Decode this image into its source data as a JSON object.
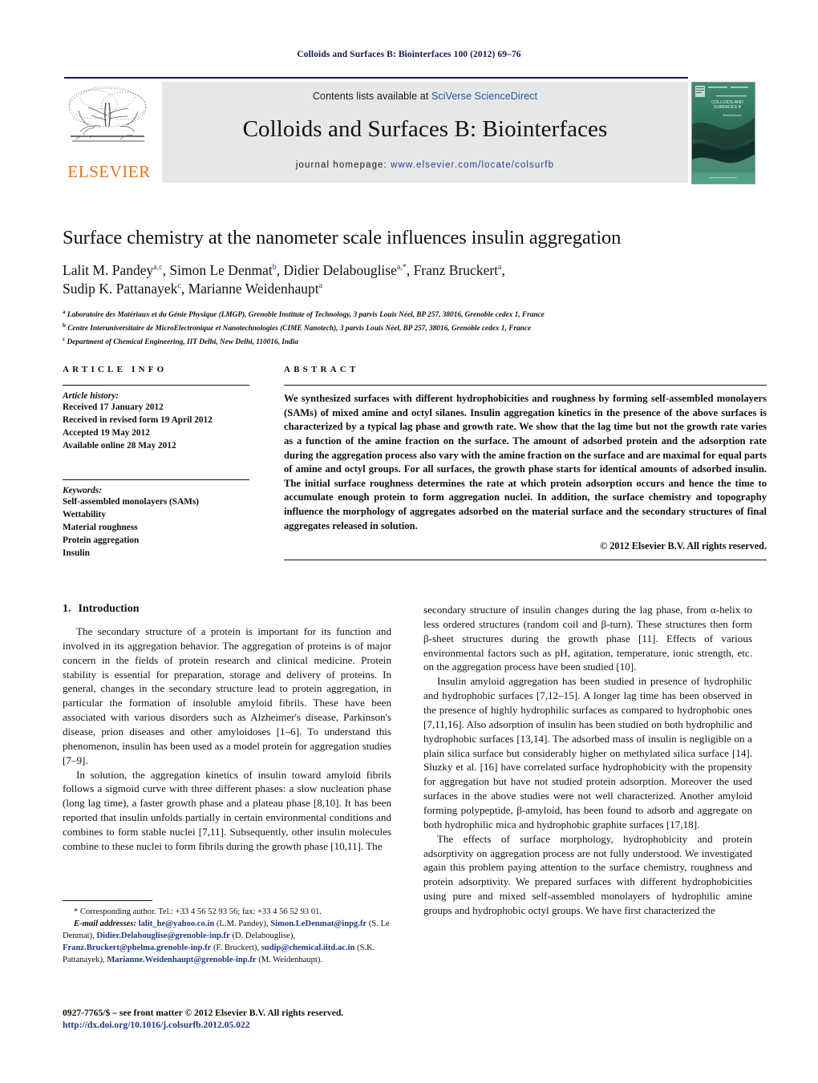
{
  "running_head": "Colloids and Surfaces B: Biointerfaces 100 (2012) 69–76",
  "masthead": {
    "contents_prefix": "Contents lists available at ",
    "sciencedirect": "SciVerse ScienceDirect",
    "journal_title": "Colloids and Surfaces B: Biointerfaces",
    "homepage_prefix": "journal homepage: ",
    "homepage_url": "www.elsevier.com/locate/colsurfb",
    "publisher": "ELSEVIER",
    "cover_line1": "COLLOIDS AND",
    "cover_line2": "SURFACES B",
    "cover_line3": "Biointerfaces",
    "accent_blue": "#0d1b56",
    "link_blue": "#2457a0",
    "elsevier_orange": "#e8731d",
    "band_gray": "#e6e7e8",
    "cover_green": "#2f7a62"
  },
  "title": "Surface chemistry at the nanometer scale influences insulin aggregation",
  "authors": [
    {
      "name": "Lalit M. Pandey",
      "sup": "a,c",
      "sep": ", "
    },
    {
      "name": "Simon Le Denmat",
      "sup": "b",
      "sep": ", "
    },
    {
      "name": "Didier Delabouglise",
      "sup": "a,*",
      "sep": ", "
    },
    {
      "name": "Franz Bruckert",
      "sup": "a",
      "sep": ","
    },
    {
      "name": "Sudip K. Pattanayek",
      "sup": "c",
      "sep": ", "
    },
    {
      "name": "Marianne Weidenhaupt",
      "sup": "a",
      "sep": ""
    }
  ],
  "affiliations": [
    {
      "marker": "a",
      "text": "Laboratoire des Matériaux et du Génie Physique (LMGP), Grenoble Institute of Technology, 3 parvis Louis Néel, BP 257, 38016, Grenoble cedex 1, France"
    },
    {
      "marker": "b",
      "text": "Centre Interuniversitaire de MicroElectronique et Nanotechnologies (CIME Nanotech), 3 parvis Louis Néel, BP 257, 38016, Grenoble cedex 1, France"
    },
    {
      "marker": "c",
      "text": "Department of Chemical Engineering, IIT Delhi, New Delhi, 110016, India"
    }
  ],
  "article_info": {
    "heading": "ARTICLE INFO",
    "history_label": "Article history:",
    "history": [
      "Received 17 January 2012",
      "Received in revised form 19 April 2012",
      "Accepted 19 May 2012",
      "Available online 28 May 2012"
    ],
    "keywords_label": "Keywords:",
    "keywords": [
      "Self-assembled monolayers (SAMs)",
      "Wettability",
      "Material roughness",
      "Protein aggregation",
      "Insulin"
    ]
  },
  "abstract": {
    "heading": "ABSTRACT",
    "text": "We synthesized surfaces with different hydrophobicities and roughness by forming self-assembled monolayers (SAMs) of mixed amine and octyl silanes. Insulin aggregation kinetics in the presence of the above surfaces is characterized by a typical lag phase and growth rate. We show that the lag time but not the growth rate varies as a function of the amine fraction on the surface. The amount of adsorbed protein and the adsorption rate during the aggregation process also vary with the amine fraction on the surface and are maximal for equal parts of amine and octyl groups. For all surfaces, the growth phase starts for identical amounts of adsorbed insulin. The initial surface roughness determines the rate at which protein adsorption occurs and hence the time to accumulate enough protein to form aggregation nuclei. In addition, the surface chemistry and topography influence the morphology of aggregates adsorbed on the material surface and the secondary structures of final aggregates released in solution.",
    "copyright": "© 2012 Elsevier B.V. All rights reserved."
  },
  "introduction": {
    "number": "1.",
    "heading": "Introduction",
    "left_paragraphs": [
      "The secondary structure of a protein is important for its function and involved in its aggregation behavior. The aggregation of proteins is of major concern in the fields of protein research and clinical medicine. Protein stability is essential for preparation, storage and delivery of proteins. In general, changes in the secondary structure lead to protein aggregation, in particular the formation of insoluble amyloid fibrils. These have been associated with various disorders such as Alzheimer's disease, Parkinson's disease, prion diseases and other amyloidoses [1–6]. To understand this phenomenon, insulin has been used as a model protein for aggregation studies [7–9].",
      "In solution, the aggregation kinetics of insulin toward amyloid fibrils follows a sigmoid curve with three different phases: a slow nucleation phase (long lag time), a faster growth phase and a plateau phase [8,10]. It has been reported that insulin unfolds partially in certain environmental conditions and combines to form stable nuclei [7,11]. Subsequently, other insulin molecules combine to these nuclei to form fibrils during the growth phase [10,11]. The"
    ],
    "right_paragraphs": [
      "secondary structure of insulin changes during the lag phase, from α-helix to less ordered structures (random coil and β-turn). These structures then form β-sheet structures during the growth phase [11]. Effects of various environmental factors such as pH, agitation, temperature, ionic strength, etc. on the aggregation process have been studied [10].",
      "Insulin amyloid aggregation has been studied in presence of hydrophilic and hydrophobic surfaces [7,12–15]. A longer lag time has been observed in the presence of highly hydrophilic surfaces as compared to hydrophobic ones [7,11,16]. Also adsorption of insulin has been studied on both hydrophilic and hydrophobic surfaces [13,14]. The adsorbed mass of insulin is negligible on a plain silica surface but considerably higher on methylated silica surface [14]. Sluzky et al. [16] have correlated surface hydrophobicity with the propensity for aggregation but have not studied protein adsorption. Moreover the used surfaces in the above studies were not well characterized. Another amyloid forming polypeptide, β-amyloid, has been found to adsorb and aggregate on both hydrophilic mica and hydrophobic graphite surfaces [17,18].",
      "The effects of surface morphology, hydrophobicity and protein adsorptivity on aggregation process are not fully understood. We investigated again this problem paying attention to the surface chemistry, roughness and protein adsorptivity. We prepared surfaces with different hydrophobicities using pure and mixed self-assembled monolayers of hydrophilic amine groups and hydrophobic octyl groups. We have first characterized the"
    ]
  },
  "footnotes": {
    "corresponding": "* Corresponding author. Tel.: +33 4 56 52 93 56; fax: +33 4 56 52 93 01.",
    "email_label": "E-mail addresses:",
    "emails": [
      {
        "address": "lalit_he@yahoo.co.in",
        "person": " (L.M. Pandey), "
      },
      {
        "address": "Simon.LeDenmat@inpg.fr",
        "person": " (S. Le Denmat), "
      },
      {
        "address": "Didier.Delabouglise@grenoble-inp.fr",
        "person": " (D. Delabouglise), "
      },
      {
        "address": "Franz.Bruckert@phelma.grenoble-inp.fr",
        "person": " (F. Bruckert), "
      },
      {
        "address": "sudip@chemical.iitd.ac.in",
        "person": " (S.K. Pattanayek), "
      },
      {
        "address": "Marianne.Weidenhaupt@grenoble-inp.fr",
        "person": " (M. Weidenhaupt)."
      }
    ],
    "issn": "0927-7765/$ – see front matter © 2012 Elsevier B.V. All rights reserved.",
    "doi": "http://dx.doi.org/10.1016/j.colsurfb.2012.05.022"
  }
}
